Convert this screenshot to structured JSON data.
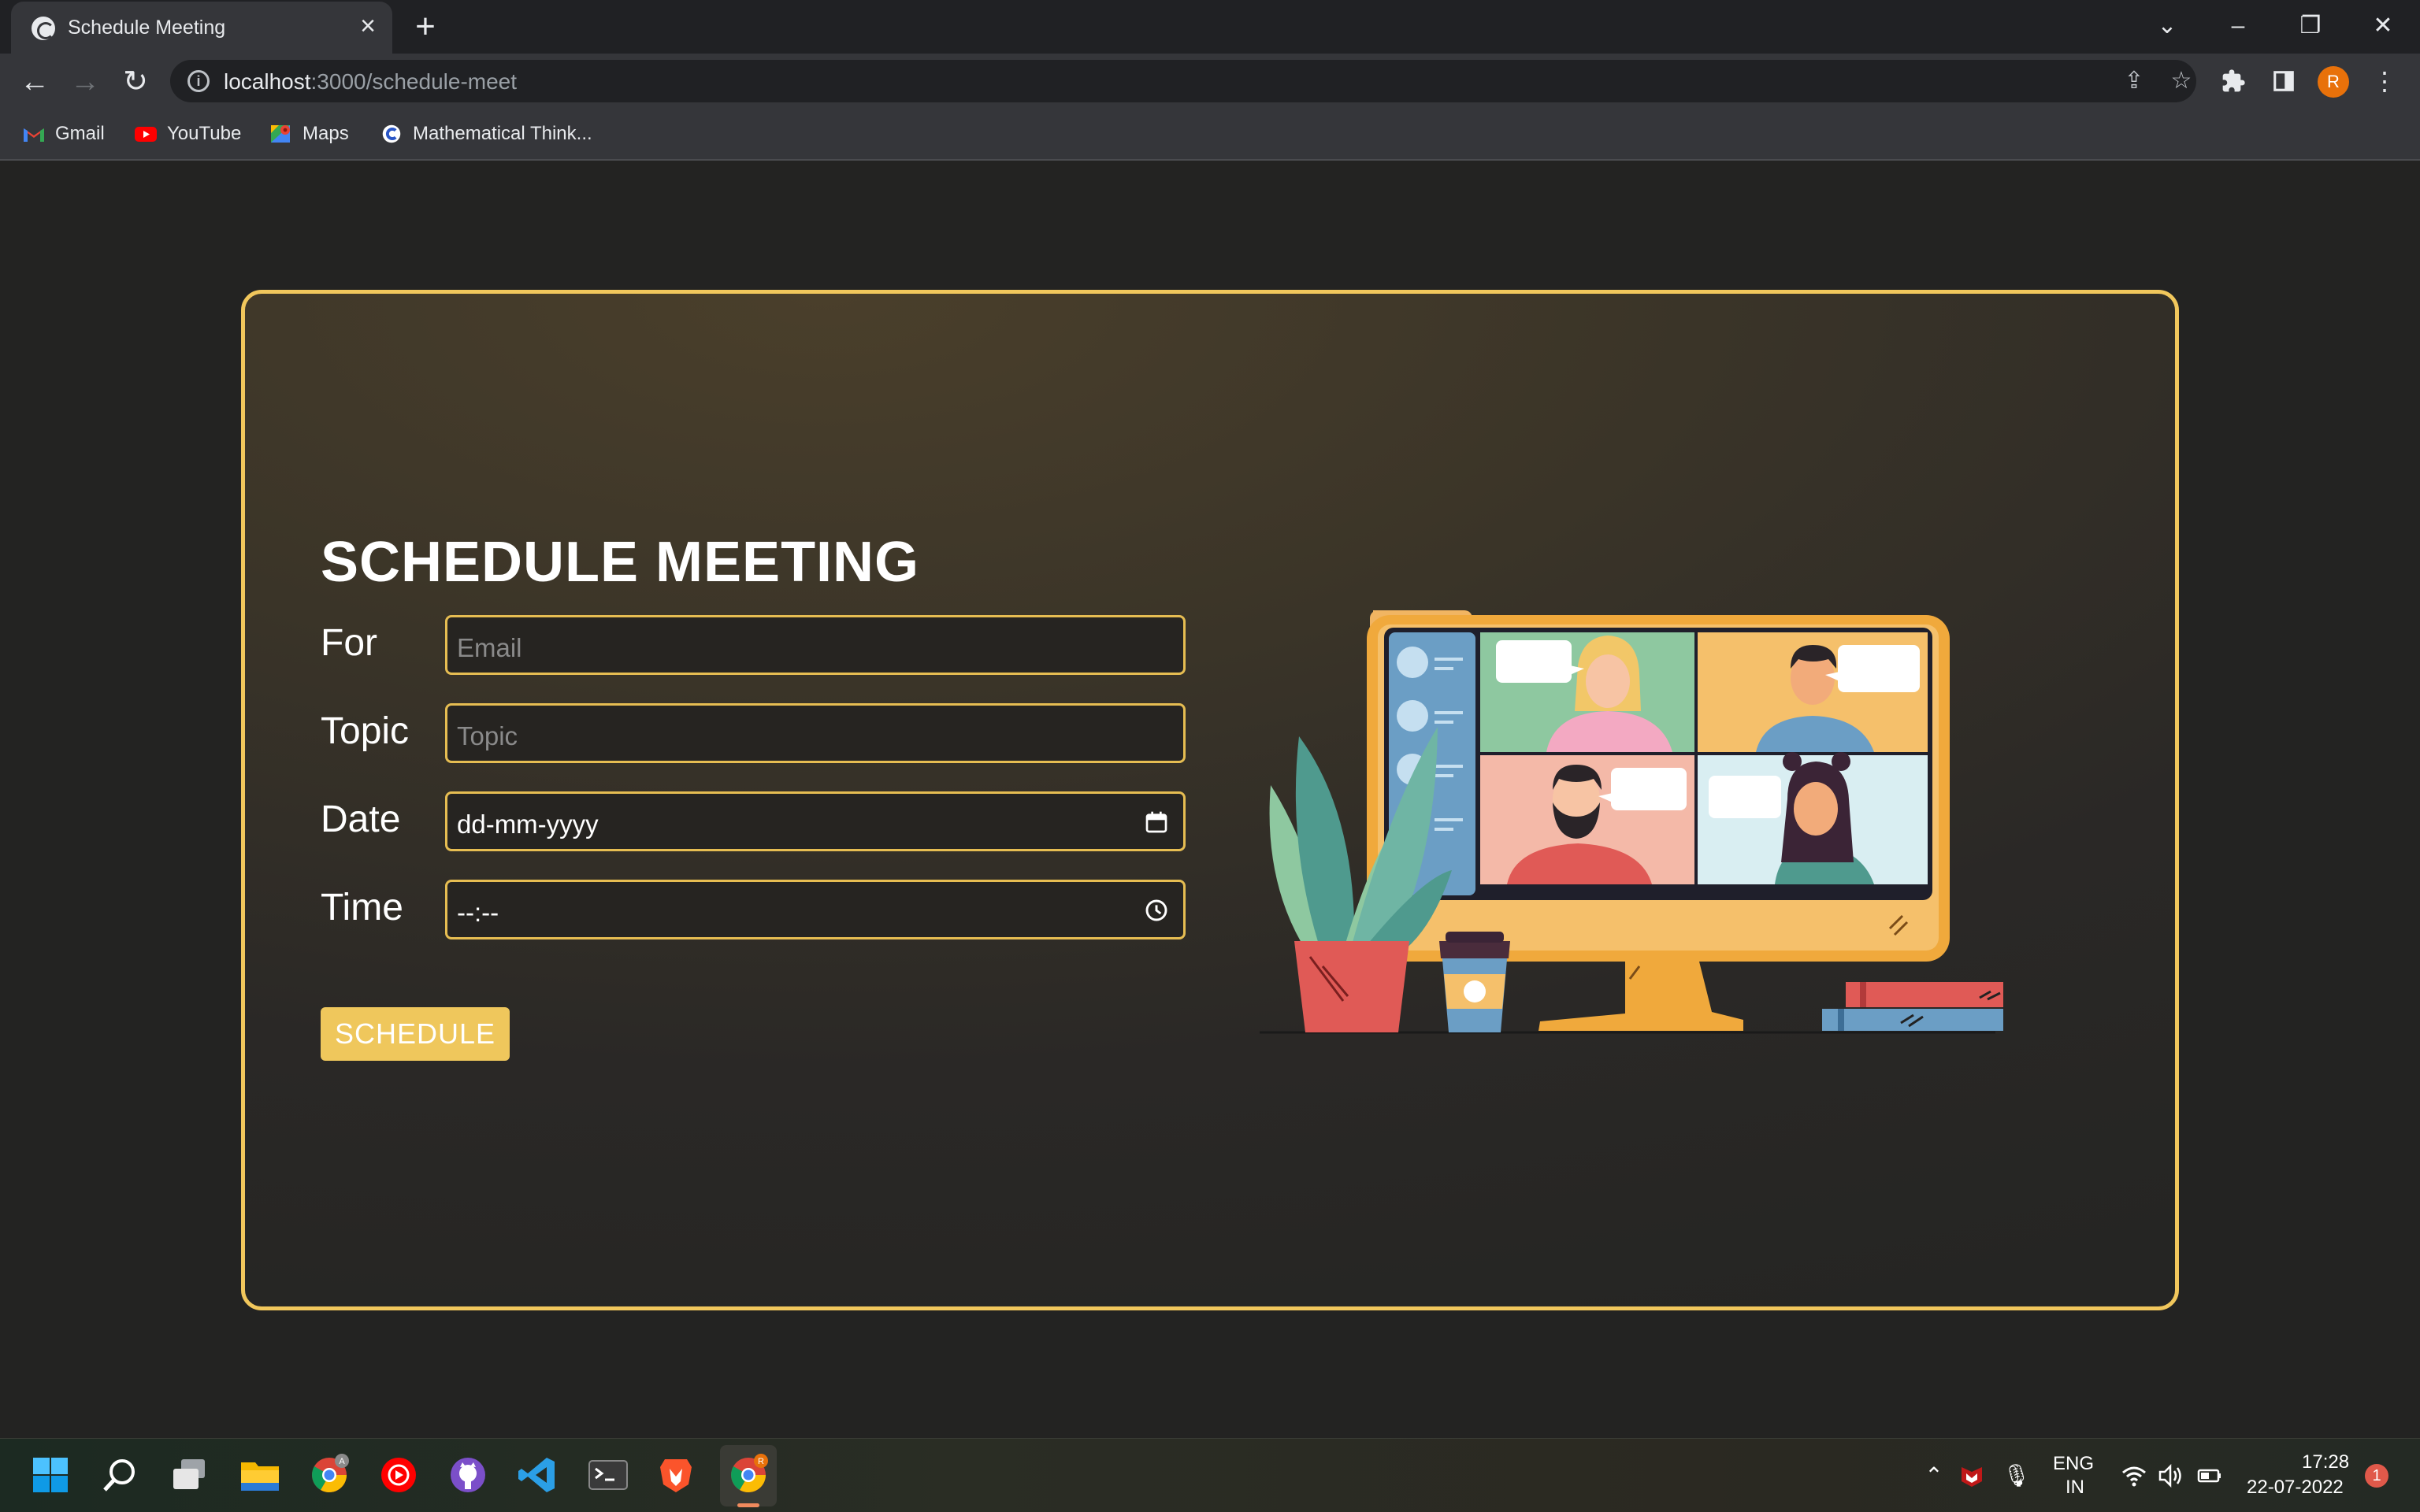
{
  "browser": {
    "tab_title": "Schedule Meeting",
    "url_host": "localhost",
    "url_path": ":3000/schedule-meet",
    "profile_initial": "R",
    "bookmarks": [
      {
        "label": "Gmail",
        "icon": "gmail-icon"
      },
      {
        "label": "YouTube",
        "icon": "youtube-icon"
      },
      {
        "label": "Maps",
        "icon": "maps-icon"
      },
      {
        "label": "Mathematical Think...",
        "icon": "coursera-icon"
      }
    ]
  },
  "form": {
    "title": "SCHEDULE MEETING",
    "for_label": "For",
    "email_placeholder": "Email",
    "topic_label": "Topic",
    "topic_placeholder": "Topic",
    "date_label": "Date",
    "date_value": "dd-mm-yyyy",
    "time_label": "Time",
    "time_value": "--:--",
    "submit_label": "SCHEDULE"
  },
  "taskbar": {
    "language_line1": "ENG",
    "language_line2": "IN",
    "time": "17:28",
    "date": "22-07-2022",
    "notification_count": "1",
    "chrome_badge": "A",
    "chrome_active_badge": "R"
  },
  "colors": {
    "accent": "#f1c75c",
    "page_bg": "#232322"
  }
}
